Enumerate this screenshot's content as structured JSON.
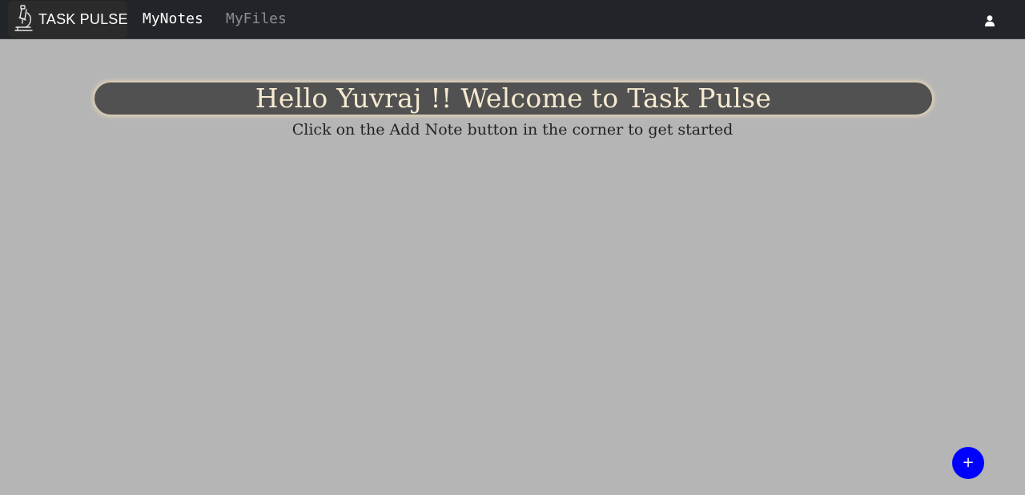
{
  "navbar": {
    "brand": {
      "logo_icon": "microscope-icon",
      "name": "TASK PULSE"
    },
    "links": [
      {
        "label": "MyNotes",
        "active": true
      },
      {
        "label": "MyFiles",
        "active": false
      }
    ],
    "user_icon": "user-icon"
  },
  "main": {
    "welcome_title": "Hello Yuvraj !! Welcome to Task Pulse",
    "subtitle": "Click on the Add Note button in the corner to get started"
  },
  "fab": {
    "label": "+",
    "icon": "plus-icon"
  },
  "colors": {
    "navbar_bg": "#212529",
    "page_bg": "#b5b5b5",
    "banner_bg": "#515151",
    "banner_text": "#f5e9cf",
    "fab_bg": "#0000ff"
  }
}
